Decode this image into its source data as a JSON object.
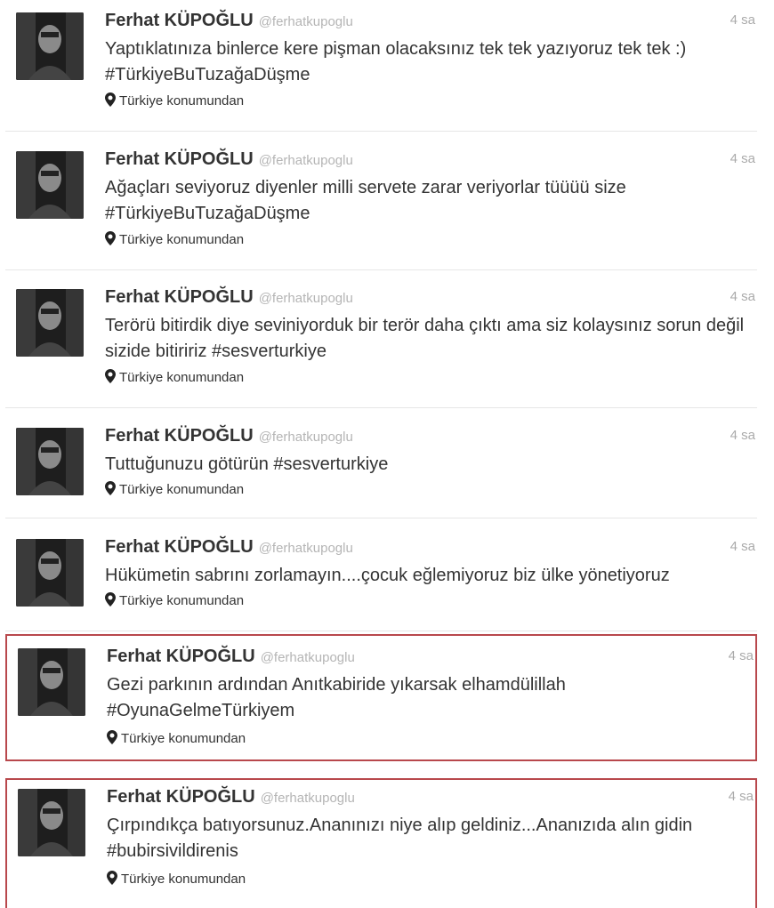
{
  "tweets": [
    {
      "name": "Ferhat KÜPOĞLU",
      "handle": "@ferhatkupoglu",
      "time": "4 sa",
      "text": "Yaptıklatınıza binlerce kere pişman olacaksınız tek tek yazıyoruz tek tek :)  #TürkiyeBuTuzağaDüşme",
      "location": "Türkiye konumundan"
    },
    {
      "name": "Ferhat KÜPOĞLU",
      "handle": "@ferhatkupoglu",
      "time": "4 sa",
      "text": "Ağaçları seviyoruz diyenler milli servete zarar veriyorlar tüüüü size #TürkiyeBuTuzağaDüşme",
      "location": "Türkiye konumundan"
    },
    {
      "name": "Ferhat KÜPOĞLU",
      "handle": "@ferhatkupoglu",
      "time": "4 sa",
      "text": "Terörü bitirdik diye seviniyorduk bir terör daha çıktı ama siz kolaysınız sorun değil sizide bitiririz  #sesverturkiye",
      "location": "Türkiye konumundan"
    },
    {
      "name": "Ferhat KÜPOĞLU",
      "handle": "@ferhatkupoglu",
      "time": "4 sa",
      "text": "Tuttuğunuzu götürün  #sesverturkiye",
      "location": "Türkiye konumundan"
    },
    {
      "name": "Ferhat KÜPOĞLU",
      "handle": "@ferhatkupoglu",
      "time": "4 sa",
      "text": "Hükümetin sabrını zorlamayın....çocuk eğlemiyoruz biz ülke yönetiyoruz",
      "location": "Türkiye konumundan"
    },
    {
      "name": "Ferhat KÜPOĞLU",
      "handle": "@ferhatkupoglu",
      "time": "4 sa",
      "text": "Gezi parkının ardından Anıtkabiride yıkarsak elhamdülillah #OyunaGelmeTürkiyem",
      "location": "Türkiye konumundan"
    },
    {
      "name": "Ferhat KÜPOĞLU",
      "handle": "@ferhatkupoglu",
      "time": "4 sa",
      "text": "Çırpındıkça batıyorsunuz.Ananınızı niye alıp geldiniz...Ananızıda alın gidin  #bubirsivildirenis",
      "location": "Türkiye konumundan"
    }
  ],
  "colors": {
    "highlight_border": "#b8484c",
    "handle": "#b5b5b5",
    "text": "#333333"
  },
  "icons": {
    "avatar": "user-photo",
    "location": "map-pin-icon"
  }
}
